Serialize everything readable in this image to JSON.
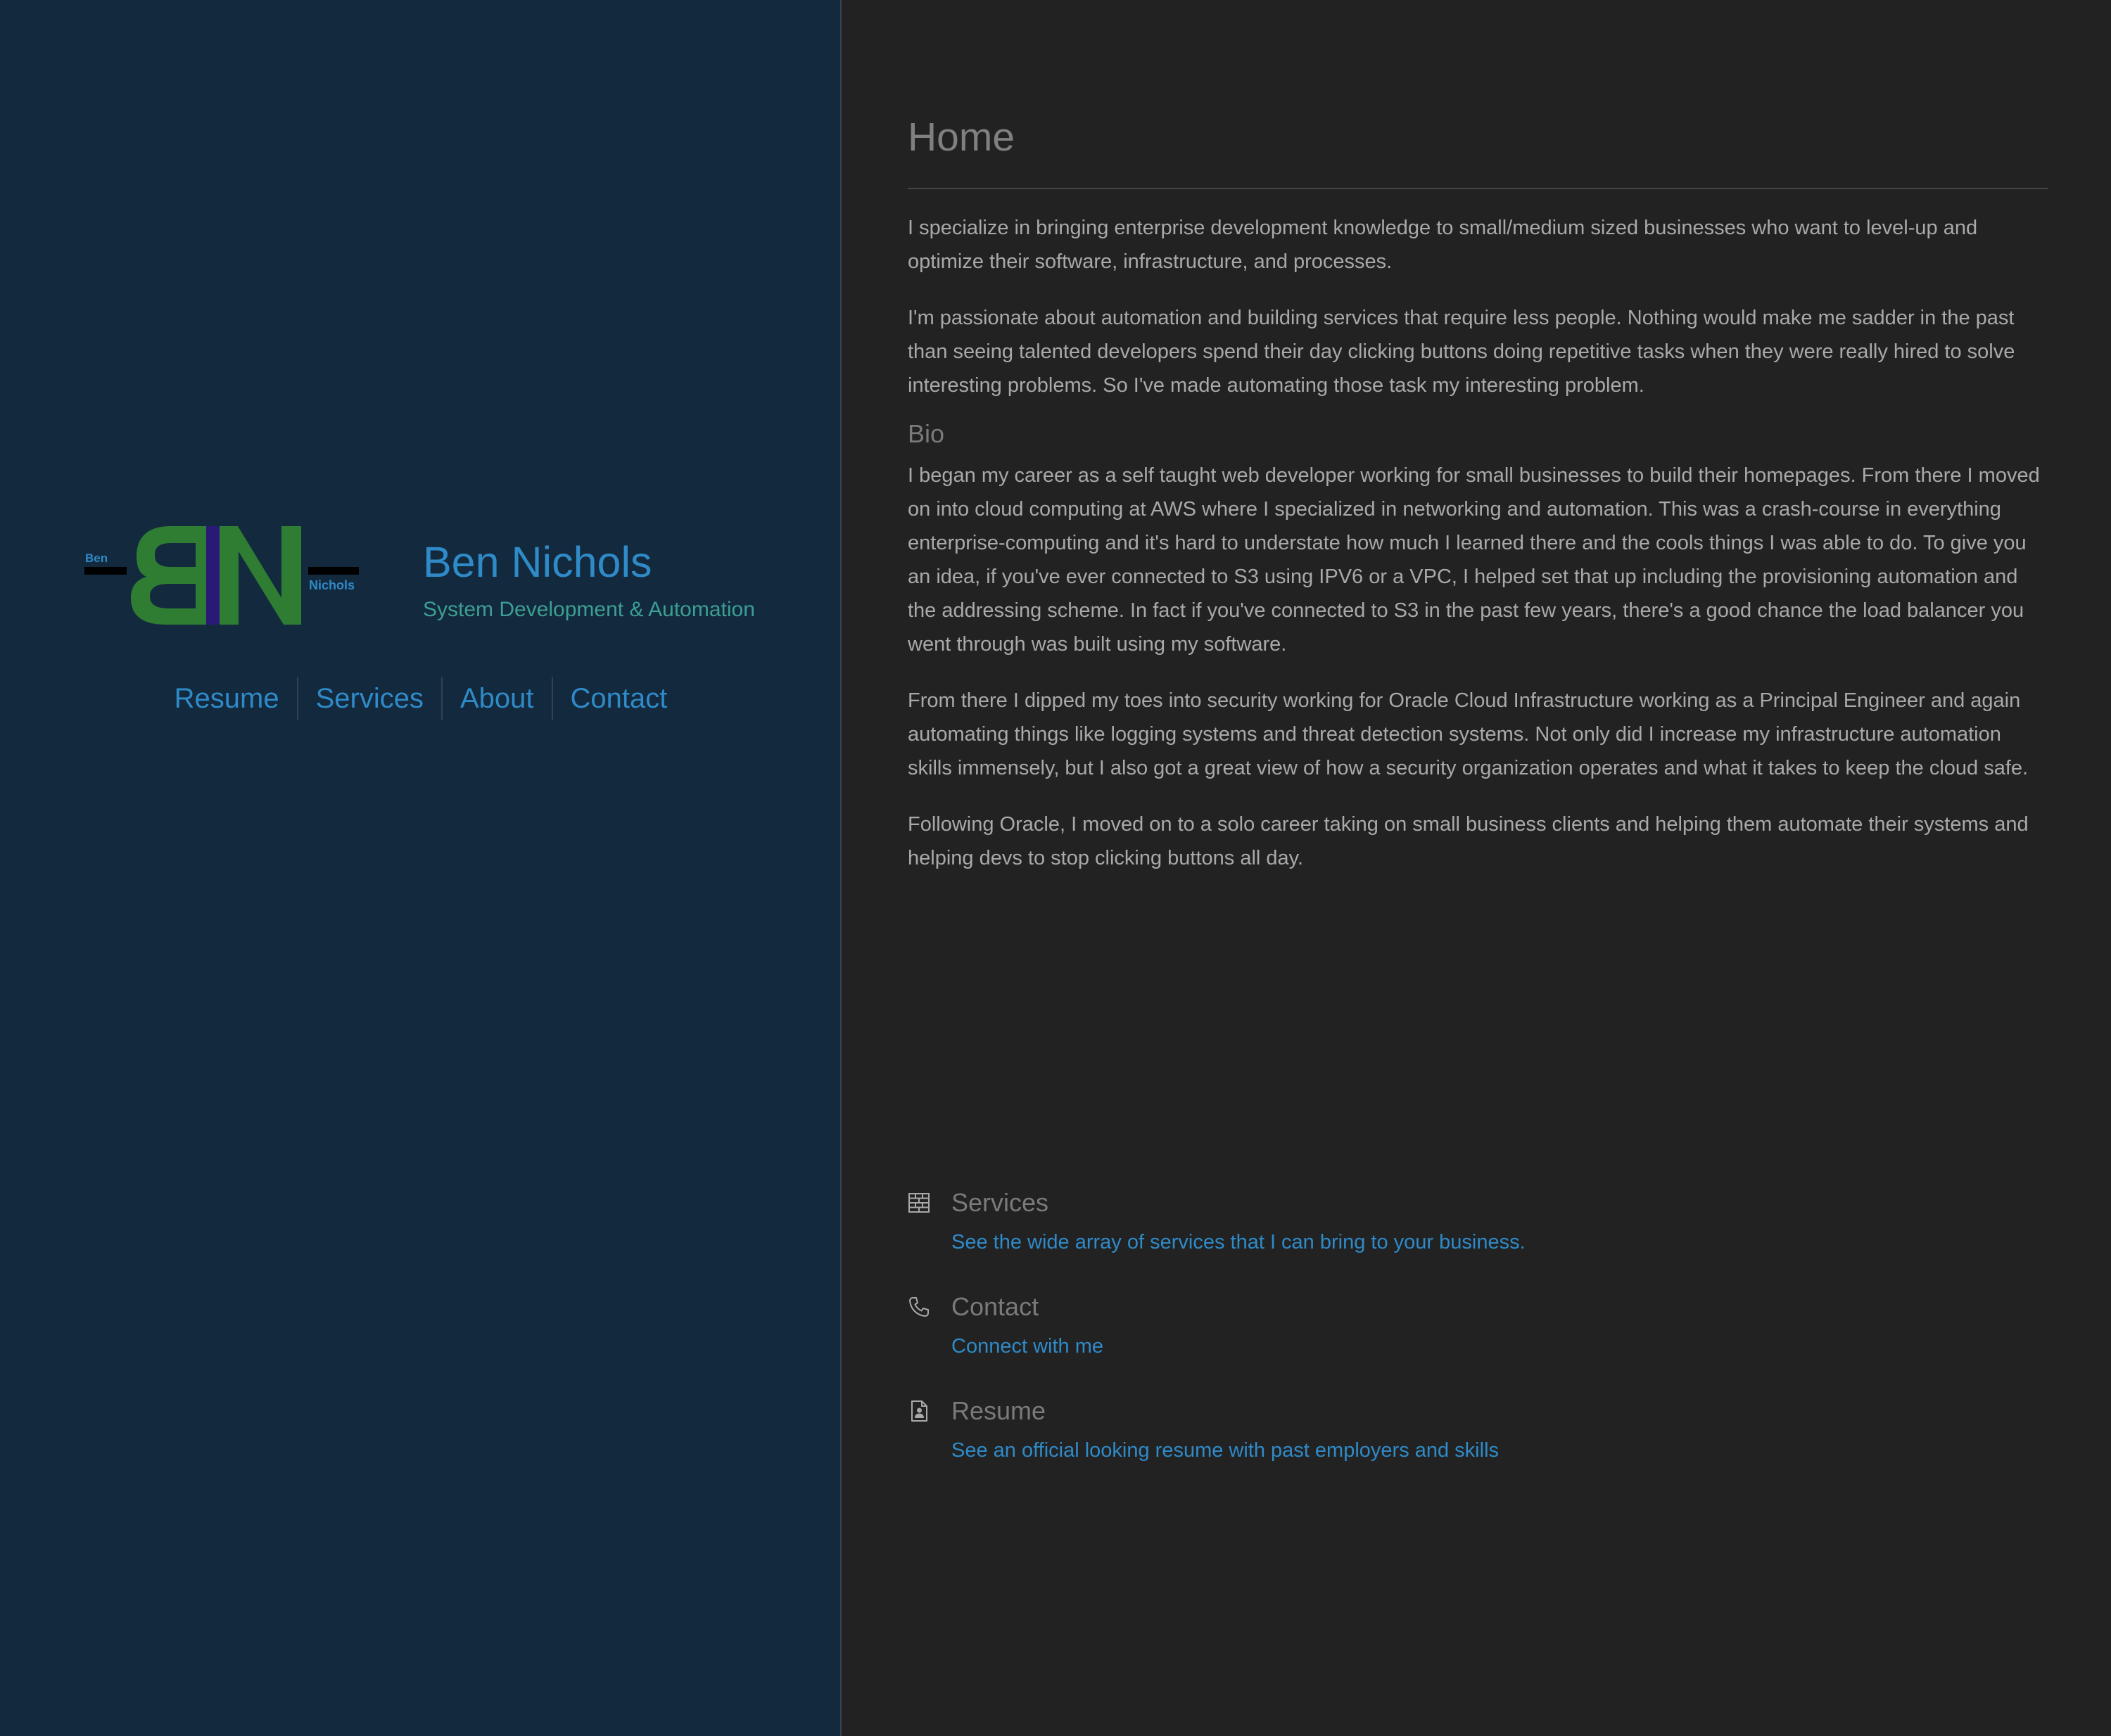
{
  "brand": {
    "logo": {
      "letters": "BN",
      "small_left": "Ben",
      "small_right": "Nichols"
    },
    "name": "Ben Nichols",
    "tagline": "System Development & Automation"
  },
  "nav": {
    "items": [
      {
        "label": "Resume"
      },
      {
        "label": "Services"
      },
      {
        "label": "About"
      },
      {
        "label": "Contact"
      }
    ]
  },
  "main": {
    "title": "Home",
    "intro": [
      "I specialize in bringing enterprise development knowledge to small/medium sized businesses who want to level-up and optimize their software, infrastructure, and processes.",
      "I'm passionate about automation and building services that require less people. Nothing would make me sadder in the past than seeing talented developers spend their day clicking buttons doing repetitive tasks when they were really hired to solve interesting problems. So I've made automating those task my interesting problem."
    ],
    "bio_heading": "Bio",
    "bio": [
      "I began my career as a self taught web developer working for small businesses to build their homepages. From there I moved on into cloud computing at AWS where I specialized in networking and automation. This was a crash-course in everything enterprise-computing and it's hard to understate how much I learned there and the cools things I was able to do. To give you an idea, if you've ever connected to S3 using IPV6 or a VPC, I helped set that up including the provisioning automation and the addressing scheme. In fact if you've connected to S3 in the past few years, there's a good chance the load balancer you went through was built using my software.",
      "From there I dipped my toes into security working for Oracle Cloud Infrastructure working as a Principal Engineer and again automating things like logging systems and threat detection systems. Not only did I increase my infrastructure automation skills immensely, but I also got a great view of how a security organization operates and what it takes to keep the cloud safe.",
      "Following Oracle, I moved on to a solo career taking on small business clients and helping them automate their systems and helping devs to stop clicking buttons all day."
    ],
    "links": [
      {
        "icon": "brick-wall-icon",
        "title": "Services",
        "description": "See the wide array of services that I can bring to your business."
      },
      {
        "icon": "phone-icon",
        "title": "Contact",
        "description": "Connect with me"
      },
      {
        "icon": "resume-document-icon",
        "title": "Resume",
        "description": "See an official looking resume with past employers and skills"
      }
    ]
  },
  "colors": {
    "sidebar_bg": "#13293d",
    "main_bg": "#222222",
    "accent_blue": "#2f8ac8",
    "accent_teal": "#3c9f94",
    "logo_green": "#2e7d32",
    "logo_purple": "#2a1a78",
    "body_text": "#a9a9a9",
    "heading_text": "#808080"
  }
}
